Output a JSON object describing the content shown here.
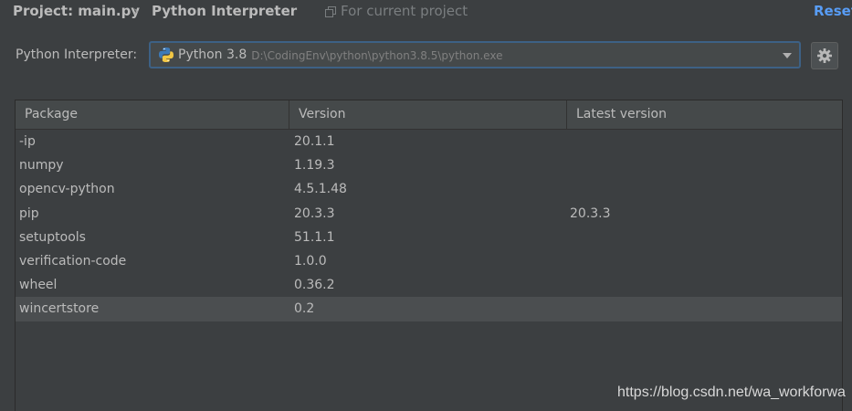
{
  "breadcrumb": {
    "project": "Project: main.py",
    "separator": "›",
    "page": "Python Interpreter",
    "scope": "For current project",
    "reset": "Reset"
  },
  "interpreter": {
    "label": "Python Interpreter:",
    "name": "Python 3.8",
    "path": "D:\\CodingEnv\\python\\python3.8.5\\python.exe"
  },
  "table": {
    "columns": [
      "Package",
      "Version",
      "Latest version"
    ],
    "rows": [
      {
        "package": "-ip",
        "version": "20.1.1",
        "latest": ""
      },
      {
        "package": "numpy",
        "version": "1.19.3",
        "latest": ""
      },
      {
        "package": "opencv-python",
        "version": "4.5.1.48",
        "latest": ""
      },
      {
        "package": "pip",
        "version": "20.3.3",
        "latest": "20.3.3"
      },
      {
        "package": "setuptools",
        "version": "51.1.1",
        "latest": ""
      },
      {
        "package": "verification-code",
        "version": "1.0.0",
        "latest": ""
      },
      {
        "package": "wheel",
        "version": "0.36.2",
        "latest": ""
      },
      {
        "package": "wincertstore",
        "version": "0.2",
        "latest": ""
      }
    ],
    "selected_row": 7
  },
  "watermark": "https://blog.csdn.net/wa_workforwa",
  "colors": {
    "accent": "#589df6",
    "background": "#3c3f41",
    "selection": "#4b4e50"
  },
  "icons": {
    "scope": "copy-icon",
    "interpreter": "python-icon",
    "dropdown": "chevron-down-icon",
    "settings": "gear-icon"
  }
}
